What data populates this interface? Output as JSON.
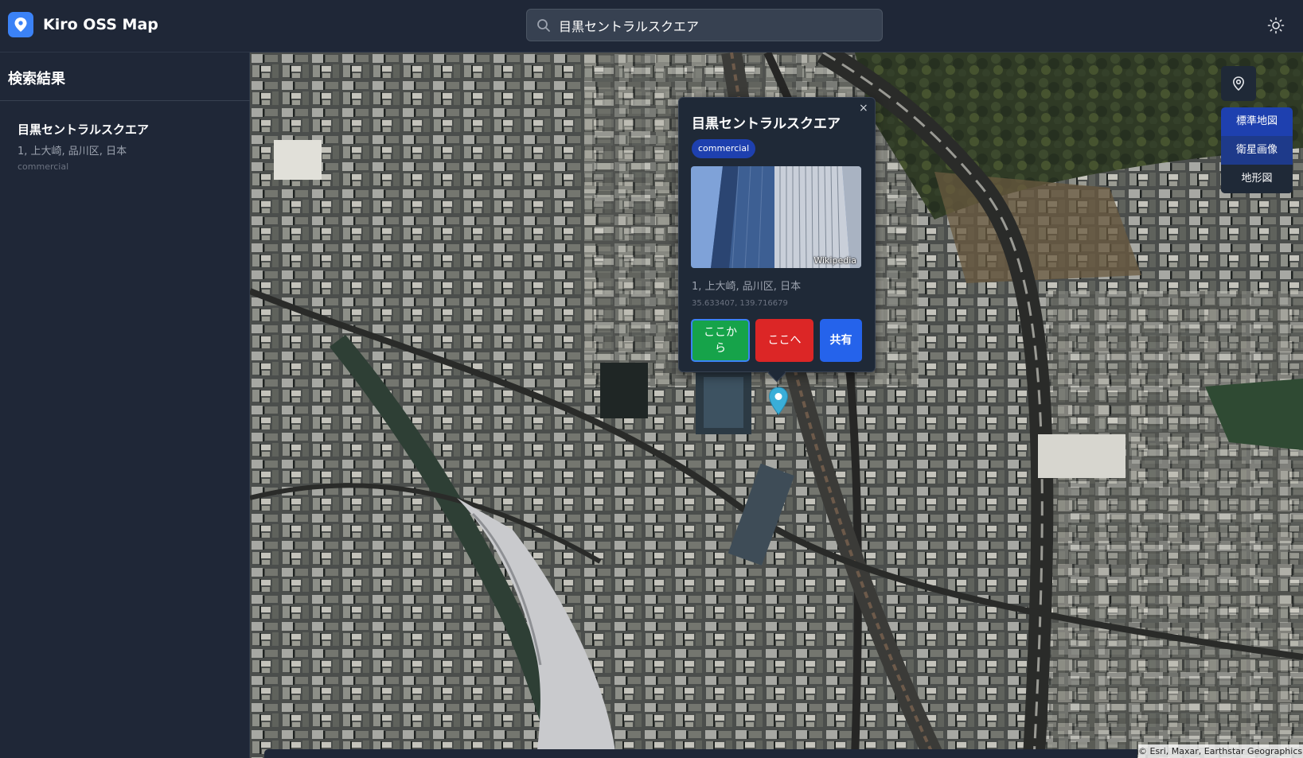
{
  "header": {
    "app_title": "Kiro OSS Map",
    "logo_icon": "map-pin-icon",
    "search": {
      "value": "目黒セントラルスクエア",
      "placeholder": ""
    },
    "theme_icon": "sun-icon"
  },
  "sidebar": {
    "title": "検索結果",
    "results": [
      {
        "name": "目黒セントラルスクエア",
        "address": "1, 上大崎, 品川区, 日本",
        "type": "commercial"
      }
    ]
  },
  "popup": {
    "close": "×",
    "title": "目黒セントラルスクエア",
    "badge": "commercial",
    "photo_credit": "Wikipedia",
    "address": "1, 上大崎, 品川区, 日本",
    "coords": "35.633407, 139.716679",
    "buttons": {
      "from": "ここから",
      "to": "ここへ",
      "share": "共有"
    }
  },
  "map": {
    "locate_icon": "location-pin-icon",
    "layers": [
      "標準地図",
      "衛星画像",
      "地形図"
    ],
    "selected_layer": "衛星画像",
    "attribution": "© Esri, Maxar, Earthstar Geographics"
  },
  "colors": {
    "accent": "#3b82f6",
    "from_button": "#16a34a",
    "to_button": "#dc2626",
    "share_button": "#2563eb",
    "marker": "#3aaed8"
  }
}
